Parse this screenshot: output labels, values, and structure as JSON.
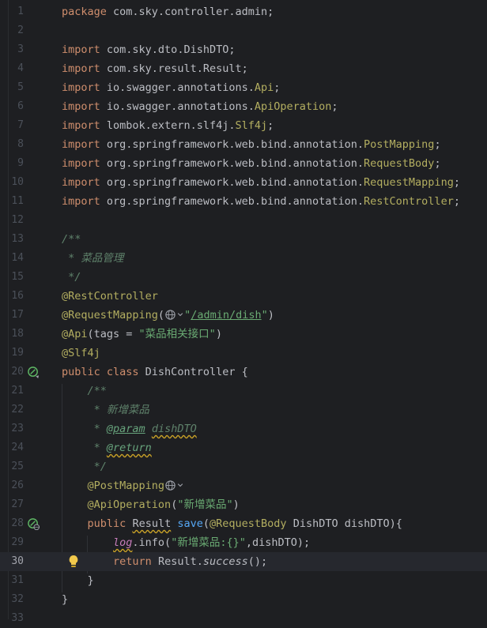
{
  "editor": {
    "current_line": 30,
    "lines": [
      {
        "n": "1",
        "html": "<span class=\"kw\">package</span> com.sky.controller.admin;"
      },
      {
        "n": "2",
        "html": ""
      },
      {
        "n": "3",
        "html": "<span class=\"kw\">import</span> com.sky.dto.DishDTO;"
      },
      {
        "n": "4",
        "html": "<span class=\"kw\">import</span> com.sky.result.Result;"
      },
      {
        "n": "5",
        "html": "<span class=\"kw\">import</span> io.swagger.annotations.<span class=\"ann\">Api</span>;"
      },
      {
        "n": "6",
        "html": "<span class=\"kw\">import</span> io.swagger.annotations.<span class=\"ann\">ApiOperation</span>;"
      },
      {
        "n": "7",
        "html": "<span class=\"kw\">import</span> lombok.extern.slf4j.<span class=\"ann\">Slf4j</span>;"
      },
      {
        "n": "8",
        "html": "<span class=\"kw\">import</span> org.springframework.web.bind.annotation.<span class=\"ann\">PostMapping</span>;"
      },
      {
        "n": "9",
        "html": "<span class=\"kw\">import</span> org.springframework.web.bind.annotation.<span class=\"ann\">RequestBody</span>;"
      },
      {
        "n": "10",
        "html": "<span class=\"kw\">import</span> org.springframework.web.bind.annotation.<span class=\"ann\">RequestMapping</span>;"
      },
      {
        "n": "11",
        "html": "<span class=\"kw\">import</span> org.springframework.web.bind.annotation.<span class=\"ann\">RestController</span>;"
      },
      {
        "n": "12",
        "html": ""
      },
      {
        "n": "13",
        "html": "<span class=\"doc\">/**</span>"
      },
      {
        "n": "14",
        "html": "<span class=\"doc\"> * 菜品管理</span>"
      },
      {
        "n": "15",
        "html": "<span class=\"doc\"> */</span>"
      },
      {
        "n": "16",
        "html": "<span class=\"ann\">@RestController</span>"
      },
      {
        "n": "17",
        "html": "<span class=\"ann\">@RequestMapping</span>(<span class=\"glyph\" data-name=\"globe-icon\" data-interactable=\"true\"><svg width=\"15\" height=\"15\" viewBox=\"0 0 16 16\"><circle cx=\"8\" cy=\"8\" r=\"6\" fill=\"none\" stroke=\"#9da0a8\" stroke-width=\"1.2\"/><ellipse cx=\"8\" cy=\"8\" rx=\"2.6\" ry=\"6\" fill=\"none\" stroke=\"#9da0a8\" stroke-width=\"1\"/><line x1=\"2\" y1=\"8\" x2=\"14\" y2=\"8\" stroke=\"#9da0a8\" stroke-width=\"1\"/></svg></span><span class=\"glyph\" data-name=\"chevron-down-icon\" data-interactable=\"true\"><svg width=\"10\" height=\"15\" viewBox=\"0 0 10 16\"><polyline points=\"2,6 5,9 8,6\" fill=\"none\" stroke=\"#9da0a8\" stroke-width=\"1.2\"/></svg></span><span class=\"str\">\"<span class=\"link\">/admin/dish</span>\"</span>)"
      },
      {
        "n": "18",
        "html": "<span class=\"ann\">@Api</span>(tags = <span class=\"str\">\"菜品相关接口\"</span>)"
      },
      {
        "n": "19",
        "html": "<span class=\"ann\">@Slf4j</span>"
      },
      {
        "n": "20",
        "html": "<span class=\"kw\">public class</span> DishController {"
      },
      {
        "n": "21",
        "html": "    <span class=\"doc\">/**</span>"
      },
      {
        "n": "22",
        "html": "<span class=\"doc\">     * 新增菜品</span>"
      },
      {
        "n": "23",
        "html": "<span class=\"doc\">     * <span class=\"doctag\">@param</span> <span class=\"squig\">dishDTO</span></span>"
      },
      {
        "n": "24",
        "html": "<span class=\"doc\">     * <span class=\"doctag squig\">@return</span></span>"
      },
      {
        "n": "25",
        "html": "<span class=\"doc\">     */</span>"
      },
      {
        "n": "26",
        "html": "    <span class=\"ann\">@PostMapping</span><span class=\"glyph\" data-name=\"globe-icon\" data-interactable=\"true\"><svg width=\"15\" height=\"15\" viewBox=\"0 0 16 16\"><circle cx=\"8\" cy=\"8\" r=\"6\" fill=\"none\" stroke=\"#9da0a8\" stroke-width=\"1.2\"/><ellipse cx=\"8\" cy=\"8\" rx=\"2.6\" ry=\"6\" fill=\"none\" stroke=\"#9da0a8\" stroke-width=\"1\"/><line x1=\"2\" y1=\"8\" x2=\"14\" y2=\"8\" stroke=\"#9da0a8\" stroke-width=\"1\"/></svg></span><span class=\"glyph\" data-name=\"chevron-down-icon\" data-interactable=\"true\"><svg width=\"10\" height=\"15\" viewBox=\"0 0 10 16\"><polyline points=\"2,6 5,9 8,6\" fill=\"none\" stroke=\"#9da0a8\" stroke-width=\"1.2\"/></svg></span>"
      },
      {
        "n": "27",
        "html": "    <span class=\"ann\">@ApiOperation</span>(<span class=\"str\">\"新增菜品\"</span>)"
      },
      {
        "n": "28",
        "html": "    <span class=\"kw\">public</span> <span class=\"squig\">Result</span> <span class=\"method\">save</span>(<span class=\"ann\">@RequestBody</span> DishDTO dishDTO){"
      },
      {
        "n": "29",
        "html": "        <span class=\"field static squig\">log</span>.info(<span class=\"str\">\"新增菜品:{}\"</span>,dishDTO);"
      },
      {
        "n": "30",
        "html": "        <span class=\"kw\">return</span> Result.<span class=\"static\">success</span>();"
      },
      {
        "n": "31",
        "html": "    }"
      },
      {
        "n": "32",
        "html": "}"
      },
      {
        "n": "33",
        "html": ""
      }
    ]
  }
}
